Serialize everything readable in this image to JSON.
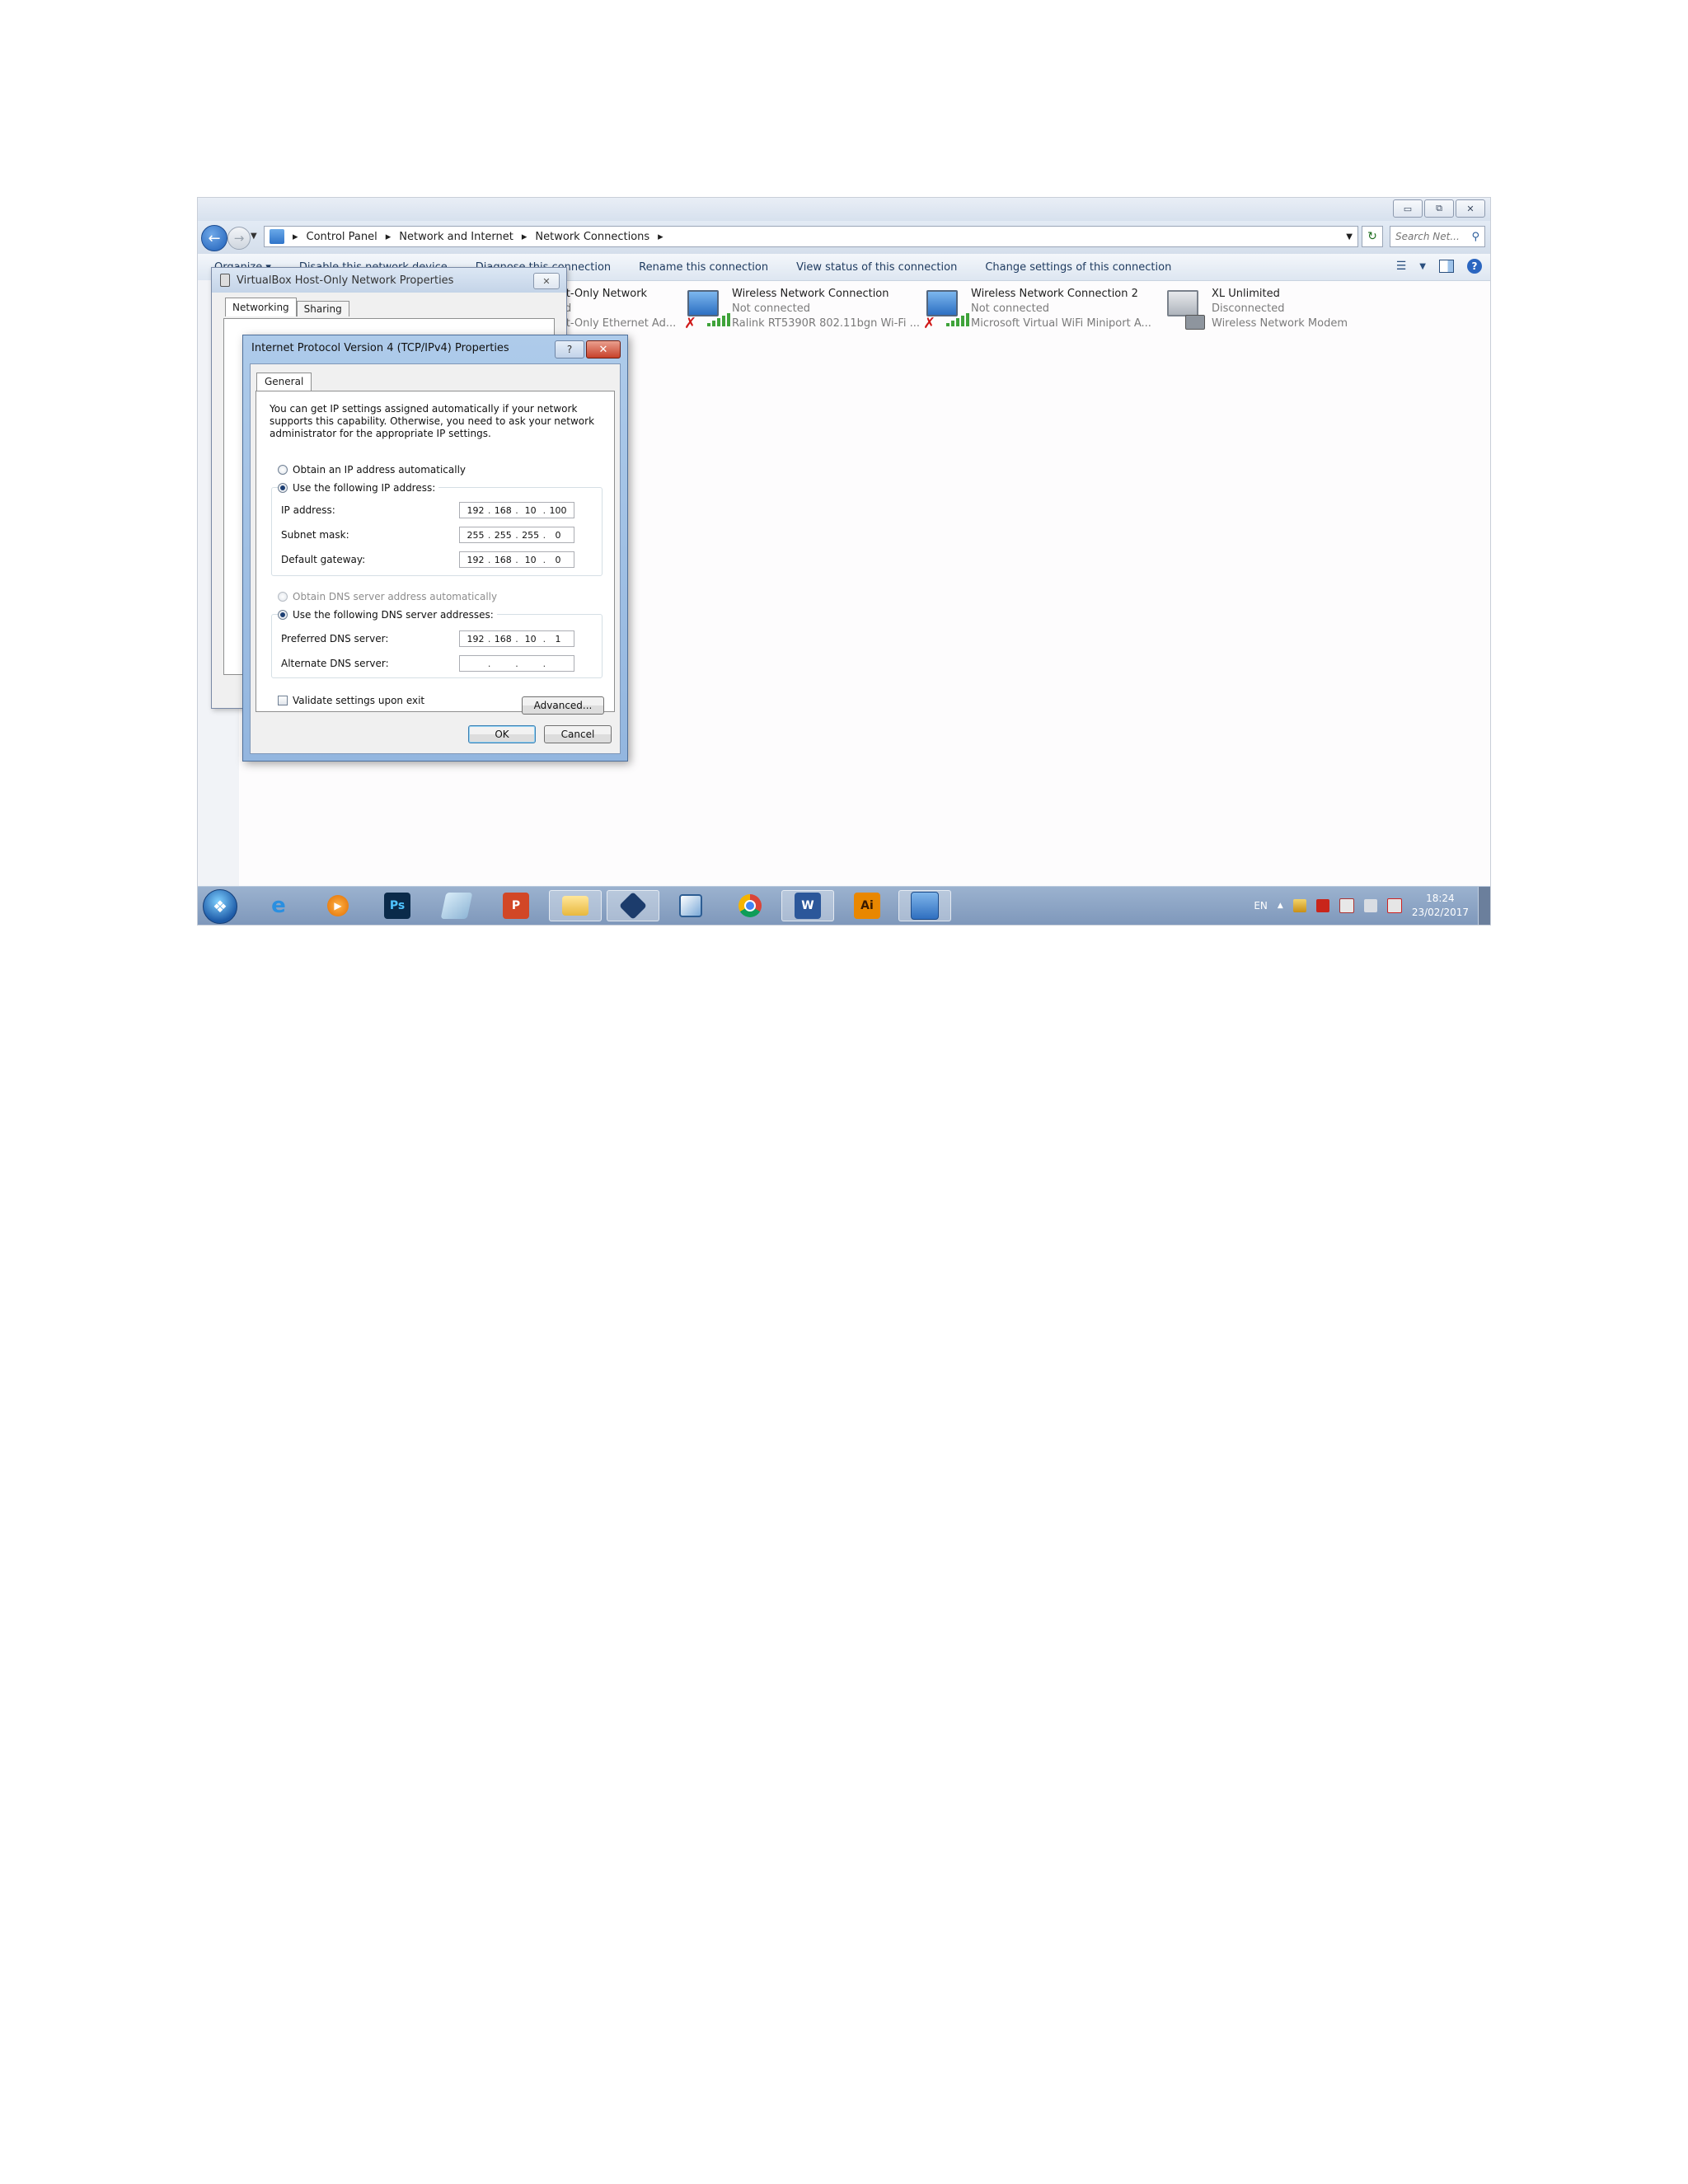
{
  "explorer": {
    "caption_buttons": [
      "▭",
      "⧉",
      "✕"
    ],
    "breadcrumb": [
      "Control Panel",
      "Network and Internet",
      "Network Connections"
    ],
    "search_placeholder": "Search Net...",
    "commands": [
      "Organize ▾",
      "Disable this network device",
      "Diagnose this connection",
      "Rename this connection",
      "View status of this connection",
      "Change settings of this connection"
    ],
    "connections": [
      {
        "name": "VirtualBox Host-Only Network",
        "status": "Enabled",
        "device": "VirtualBox Host-Only Ethernet Ad...",
        "visible_name": "ost-Only Network",
        "visible_status": "red",
        "visible_device": "ost-Only Ethernet Ad..."
      },
      {
        "name": "Wireless Network Connection",
        "status": "Not connected",
        "device": "Ralink RT5390R 802.11bgn Wi-Fi ..."
      },
      {
        "name": "Wireless Network Connection 2",
        "status": "Not connected",
        "device": "Microsoft Virtual WiFi Miniport A..."
      },
      {
        "name": "XL Unlimited",
        "status": "Disconnected",
        "device": "Wireless Network Modem"
      }
    ]
  },
  "vbox_dialog": {
    "title": "VirtualBox Host-Only Network Properties",
    "tabs": [
      "Networking",
      "Sharing"
    ],
    "close": "✕"
  },
  "ipv4_dialog": {
    "title": "Internet Protocol Version 4 (TCP/IPv4) Properties",
    "help": "?",
    "close": "✕",
    "tab": "General",
    "intro": "You can get IP settings assigned automatically if your network supports this capability. Otherwise, you need to ask your network administrator for the appropriate IP settings.",
    "obtain_ip_auto": "Obtain an IP address automatically",
    "use_following_ip": "Use the following IP address:",
    "ip_fields": [
      {
        "label": "IP address:",
        "octets": [
          "192",
          "168",
          "10",
          "100"
        ]
      },
      {
        "label": "Subnet mask:",
        "octets": [
          "255",
          "255",
          "255",
          "0"
        ]
      },
      {
        "label": "Default gateway:",
        "octets": [
          "192",
          "168",
          "10",
          "0"
        ]
      }
    ],
    "obtain_dns_auto": "Obtain DNS server address automatically",
    "use_following_dns": "Use the following DNS server addresses:",
    "dns_fields": [
      {
        "label": "Preferred DNS server:",
        "octets": [
          "192",
          "168",
          "10",
          "1"
        ]
      },
      {
        "label": "Alternate DNS server:",
        "octets": [
          "",
          "",
          "",
          ""
        ]
      }
    ],
    "validate_label": "Validate settings upon exit",
    "advanced_button": "Advanced...",
    "ok_button": "OK",
    "cancel_button": "Cancel"
  },
  "taskbar": {
    "apps": [
      "internet-explorer",
      "media-player",
      "photoshop",
      "notes",
      "powerpoint",
      "file-explorer",
      "virtualbox",
      "box-app",
      "chrome",
      "word",
      "illustrator",
      "network-control-panel"
    ],
    "app_labels": {
      "photoshop": "Ps",
      "powerpoint": "P",
      "word": "W",
      "illustrator": "Ai"
    },
    "language": "EN",
    "tray_arrow": "▲",
    "time": "18:24",
    "date": "23/02/2017"
  },
  "colors": {
    "accent": "#1e5fb8",
    "close_red": "#c7412a",
    "signal_green": "#3fa33a"
  }
}
